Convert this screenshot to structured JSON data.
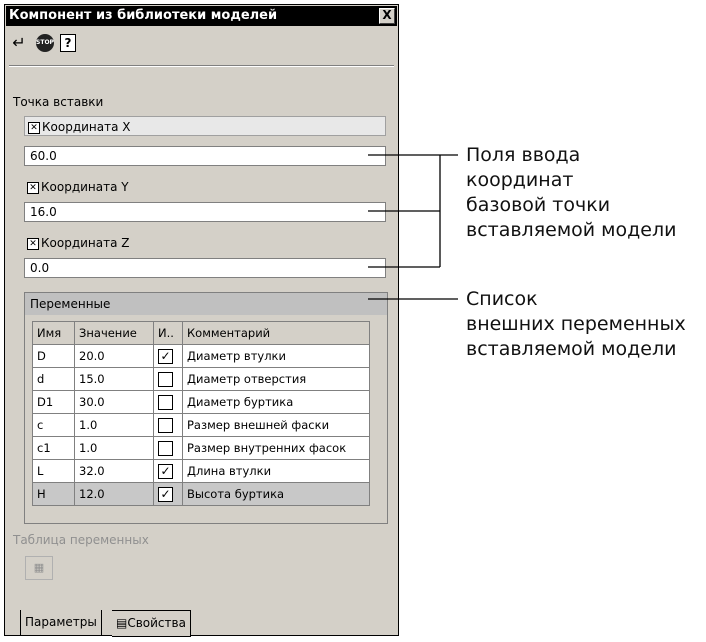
{
  "window": {
    "title": "Компонент из библиотеки моделей",
    "close_label": "X"
  },
  "toolbar": {
    "enter_icon": "enter-arrow-icon",
    "stop_label": "STOP",
    "help_label": "?"
  },
  "insert_point": {
    "heading": "Точка вставки",
    "coords": [
      {
        "label": "Координата X",
        "value": "60.0"
      },
      {
        "label": "Координата Y",
        "value": "16.0"
      },
      {
        "label": "Координата Z",
        "value": "0.0"
      }
    ]
  },
  "variables": {
    "heading": "Переменные",
    "columns": [
      "Имя",
      "Значение",
      "И..",
      "Комментарий"
    ],
    "rows": [
      {
        "name": "D",
        "value": "20.0",
        "checked": true,
        "comment": "Диаметр втулки"
      },
      {
        "name": "d",
        "value": "15.0",
        "checked": false,
        "comment": "Диаметр отверстия"
      },
      {
        "name": "D1",
        "value": "30.0",
        "checked": false,
        "comment": "Диаметр буртика"
      },
      {
        "name": "c",
        "value": "1.0",
        "checked": false,
        "comment": "Размер внешней фаски"
      },
      {
        "name": "c1",
        "value": "1.0",
        "checked": false,
        "comment": "Размер внутренних фасок"
      },
      {
        "name": "L",
        "value": "32.0",
        "checked": true,
        "comment": "Длина втулки"
      },
      {
        "name": "H",
        "value": "12.0",
        "checked": true,
        "comment": "Высота буртика"
      }
    ]
  },
  "var_table": {
    "label": "Таблица переменных"
  },
  "tabs": [
    {
      "label": "Параметры"
    },
    {
      "label": "Свойства"
    }
  ],
  "callouts": {
    "coords_lines": [
      "Поля ввода",
      "координат",
      "базовой точки",
      "вставляемой модели"
    ],
    "vars_lines": [
      "Список",
      "внешних переменных",
      "вставляемой модели"
    ]
  }
}
